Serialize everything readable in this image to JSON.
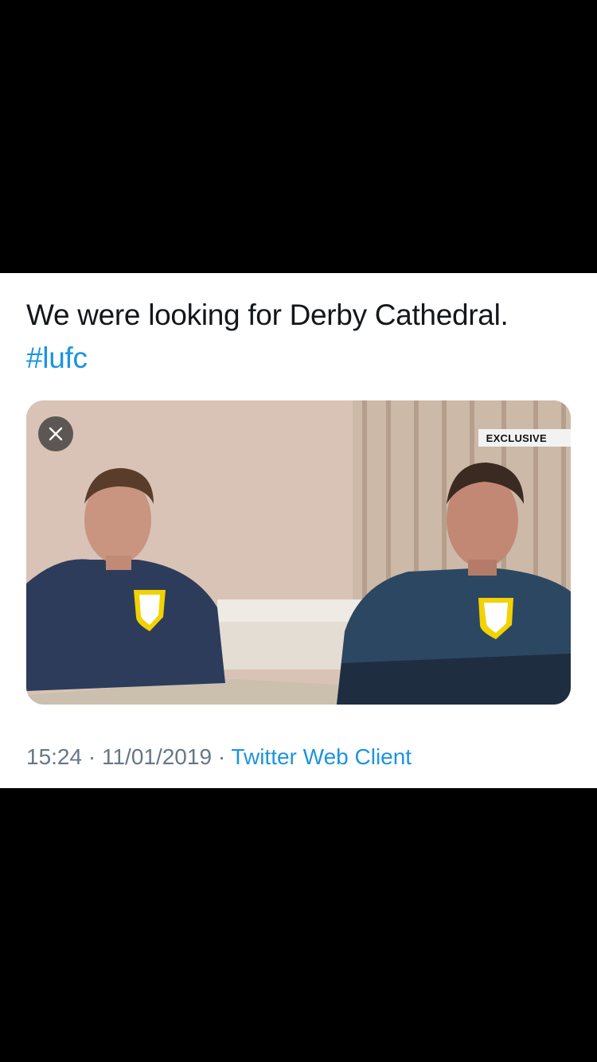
{
  "tweet": {
    "text": "We were looking for Derby Cathedral.",
    "hashtag": "#lufc"
  },
  "media": {
    "badge": "EXCLUSIVE",
    "close_icon": "close-icon"
  },
  "meta": {
    "time": "15:24",
    "separator": "·",
    "date": "11/01/2019",
    "source": "Twitter Web Client"
  },
  "colors": {
    "link": "#1b95e0",
    "text": "#14171a",
    "meta": "#657786"
  }
}
